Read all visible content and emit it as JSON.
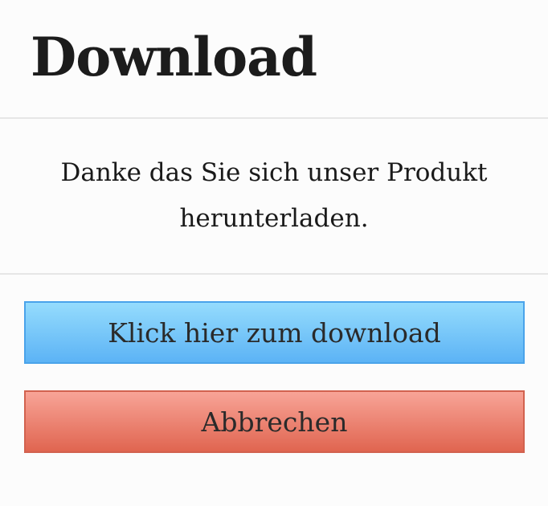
{
  "dialog": {
    "title": "Download",
    "message": "Danke das Sie sich unser Produkt herunterladen.",
    "download_button_label": "Klick hier zum download",
    "cancel_button_label": "Abbrechen"
  },
  "colors": {
    "download_button_top": "#95dcfd",
    "download_button_bottom": "#5cb3f5",
    "cancel_button_top": "#f8a497",
    "cancel_button_bottom": "#e06550",
    "divider": "#e6e6e6",
    "background": "#fcfcfc"
  }
}
